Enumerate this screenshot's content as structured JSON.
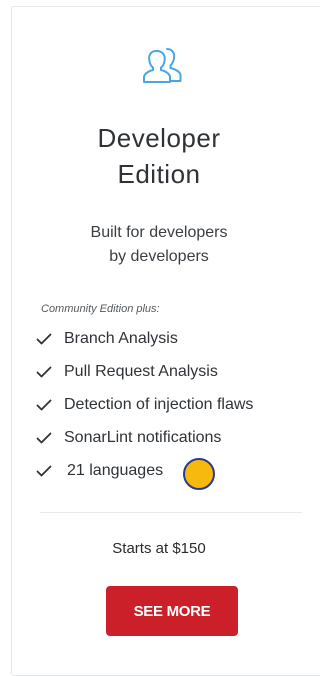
{
  "edition": {
    "icon": "users-icon",
    "title_line1": "Developer",
    "title_line2": "Edition",
    "tagline_line1": "Built for developers",
    "tagline_line2": "by developers",
    "plus_label": "Community Edition plus:",
    "features": [
      "Branch Analysis",
      "Pull Request Analysis",
      "Detection of injection flaws",
      "SonarLint notifications",
      "21 languages"
    ],
    "price": "Starts at $150",
    "cta_label": "SEE MORE"
  },
  "colors": {
    "accent_icon": "#4aa6e2",
    "cta_background": "#cb2029",
    "cta_text": "#ffffff",
    "cursor_fill": "#f7b90d",
    "cursor_border": "#2a3a8c"
  }
}
